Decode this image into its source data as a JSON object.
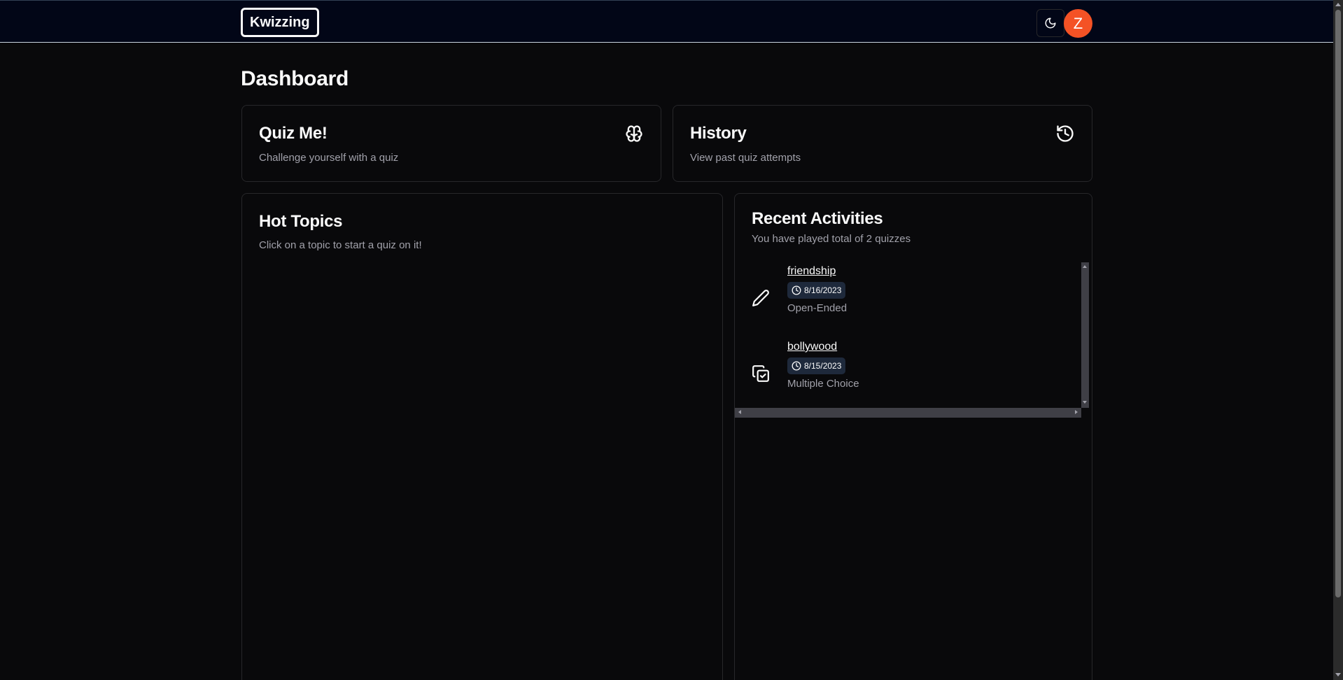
{
  "header": {
    "logo": "Kwizzing",
    "avatar_initial": "Z",
    "theme_icon": "moon-icon"
  },
  "page": {
    "title": "Dashboard"
  },
  "quiz_card": {
    "title": "Quiz Me!",
    "subtitle": "Challenge yourself with a quiz",
    "icon": "brain-icon"
  },
  "history_card": {
    "title": "History",
    "subtitle": "View past quiz attempts",
    "icon": "history-icon"
  },
  "hot_topics": {
    "title": "Hot Topics",
    "subtitle": "Click on a topic to start a quiz on it!"
  },
  "recent": {
    "title": "Recent Activities",
    "subtitle": "You have played total of 2 quizzes",
    "items": [
      {
        "topic": "friendship",
        "date": "8/16/2023",
        "type": "Open-Ended",
        "icon": "pencil-icon"
      },
      {
        "topic": "bollywood",
        "date": "8/15/2023",
        "type": "Multiple Choice",
        "icon": "copy-check-icon"
      }
    ]
  },
  "colors": {
    "background": "#09090b",
    "navbar": "#020617",
    "avatar": "#f45225",
    "muted_text": "#a1a1aa",
    "badge": "#1e293b"
  }
}
